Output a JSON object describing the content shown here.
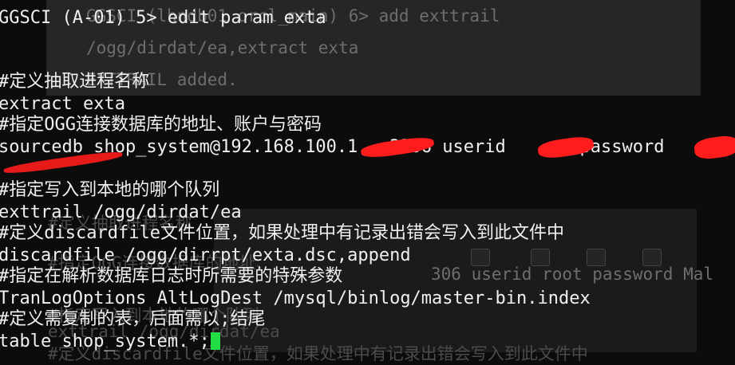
{
  "ghost_top": {
    "line1": "GGSCI (lhndb01 orcl_main) 6> add exttrail",
    "line2": "/ogg/dirdat/ea,extract exta",
    "line3": "EXTTRAIL added."
  },
  "ghost_bottom": {
    "line1": "#定义抽取进程名称",
    "line2": "#指定OGG连接数据库的地址、",
    "line3": "306 userid root password Mal",
    "line4": "#指定写入到本地的哪个队列",
    "line5": "exttrail /ogg/dirdat/ea",
    "line6": "#定义discardfile文件位置，如果处理中有记录出错会写入到此文件中"
  },
  "terminal": {
    "lines": [
      "GGSCI (A-01) 5> edit param exta",
      "",
      "",
      "#定义抽取进程名称",
      "extract exta",
      "#指定OGG连接数据库的地址、账户与密码",
      "sourcedb shop_system@192.168.100.1  :3306 userid       password",
      "",
      "#指定写入到本地的哪个队列",
      "exttrail /ogg/dirdat/ea",
      "#定义discardfile文件位置，如果处理中有记录出错会写入到此文件中",
      "discardfile /ogg/dirrpt/exta.dsc,append",
      "#指定在解析数据库日志时所需要的特殊参数",
      "TranLogOptions AltLogDest /mysql/binlog/master-bin.index",
      "#定义需复制的表，后面需以;结尾",
      "table shop_system.*;"
    ]
  },
  "colors": {
    "background": "#0c0c0c",
    "text": "#f0f0f0",
    "cursor": "#22dd44",
    "redaction": "#ff1c1c"
  }
}
